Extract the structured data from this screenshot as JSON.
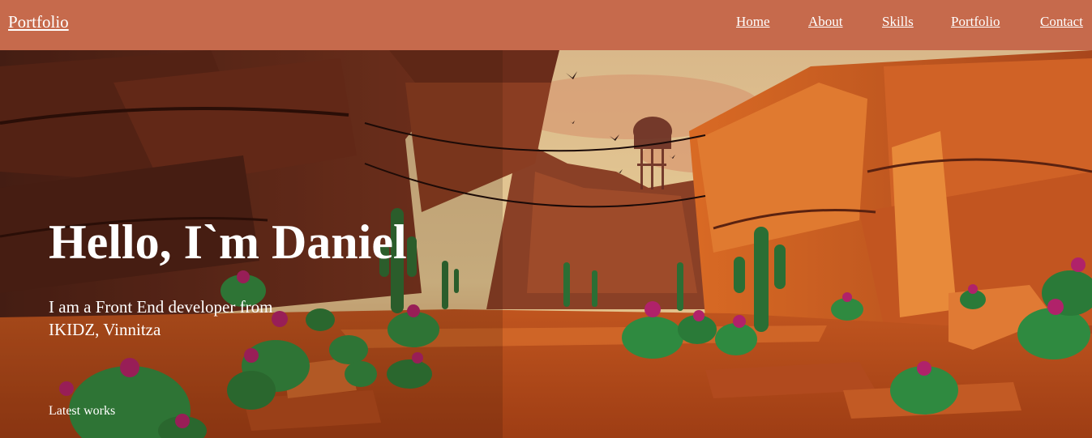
{
  "header": {
    "brand": "Portfolio",
    "nav": [
      "Home",
      "About",
      "Skills",
      "Portfolio",
      "Contact"
    ]
  },
  "hero": {
    "title": "Hello, I`m Daniel",
    "subtitle": "I am a Front End developer from IKIDZ, Vinnitza",
    "latest_label": "Latest works"
  },
  "colors": {
    "header_bg": "#c66a4c",
    "text": "#ffffff",
    "canyon_dark": "#5a2a18",
    "canyon_orange": "#d9692a",
    "sky": "#e9cf98",
    "cactus": "#2e8a3e",
    "flower": "#b0226a"
  }
}
